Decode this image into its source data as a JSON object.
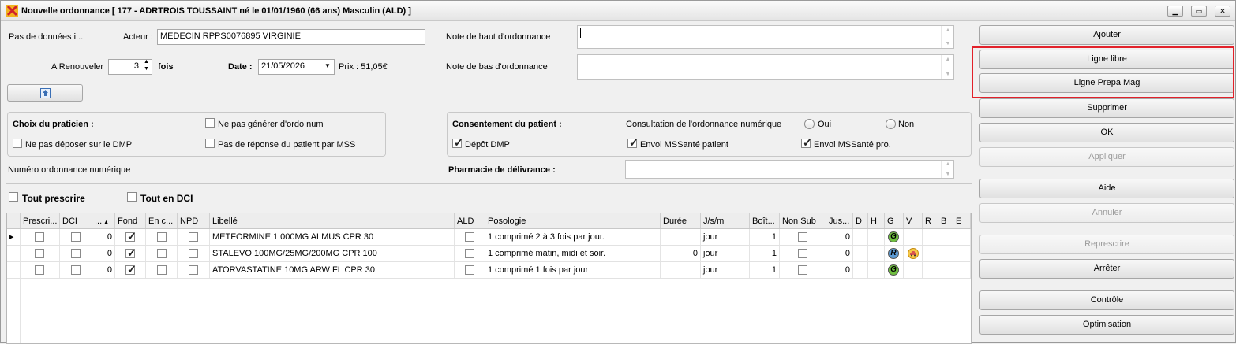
{
  "window": {
    "title": "Nouvelle ordonnance [ 177 -  ADRTROIS TOUSSAINT né le 01/01/1960 (66 ans) Masculin  (ALD) ]",
    "icon": "app-logo-icon",
    "controls": [
      "minimize-icon",
      "maximize-icon",
      "close-icon"
    ]
  },
  "header": {
    "no_data": "Pas de données i...",
    "actor_label": "Acteur :",
    "actor_value": "MEDECIN RPPS0076895 VIRGINIE",
    "renew_label": "A Renouveler",
    "renew_value": "3",
    "renew_unit": "fois",
    "date_label": "Date :",
    "date_value": "21/05/2026",
    "price": "Prix : 51,05€",
    "top_note_label": "Note de haut d'ordonnance",
    "bottom_note_label": "Note de bas d'ordonnance"
  },
  "praticien": {
    "title": "Choix du praticien :",
    "opt1": "Ne pas générer d'ordo num",
    "opt2": "Ne pas déposer sur le DMP",
    "opt3": "Pas de réponse du patient par MSS"
  },
  "patient": {
    "title": "Consentement du patient :",
    "consult_label": "Consultation de l'ordonnance numérique",
    "oui": "Oui",
    "non": "Non",
    "depot": "Dépôt DMP",
    "envoi_patient": "Envoi MSSanté patient",
    "envoi_pro": "Envoi MSSanté pro."
  },
  "numero_label": "Numéro ordonnance numérique",
  "pharmacie_label": "Pharmacie de délivrance :",
  "tout_prescrire": "Tout prescrire",
  "tout_dci": "Tout en DCI",
  "grid": {
    "columns": [
      "Prescri...",
      "DCI",
      "...",
      "Fond",
      "En c...",
      "NPD",
      "Libellé",
      "ALD",
      "Posologie",
      "Durée",
      "J/s/m",
      "Boît...",
      "Non Sub",
      "Jus...",
      "D",
      "H",
      "G",
      "V",
      "R",
      "B",
      "E"
    ],
    "rows": [
      {
        "num": "0",
        "fond": true,
        "libelle": "METFORMINE 1 000MG ALMUS CPR 30",
        "posologie": "1 comprimé 2 à 3 fois par jour.",
        "duree": "",
        "jsm": "jour",
        "boites": "1",
        "jus": "0",
        "g": "G",
        "v": ""
      },
      {
        "num": "0",
        "fond": true,
        "libelle": "STALEVO 100MG/25MG/200MG CPR 100",
        "posologie": "1 comprimé matin, midi et soir.",
        "duree": "0",
        "jsm": "jour",
        "boites": "1",
        "jus": "0",
        "g": "R",
        "v": "car-icon"
      },
      {
        "num": "0",
        "fond": true,
        "libelle": "ATORVASTATINE 10MG ARW FL CPR 30",
        "posologie": "1 comprimé 1 fois par jour",
        "duree": "",
        "jsm": "jour",
        "boites": "1",
        "jus": "0",
        "g": "G",
        "v": ""
      }
    ]
  },
  "buttons": {
    "ajouter": "Ajouter",
    "ligne_libre": "Ligne libre",
    "ligne_prepa": "Ligne Prepa Mag",
    "supprimer": "Supprimer",
    "ok": "OK",
    "appliquer": "Appliquer",
    "aide": "Aide",
    "annuler": "Annuler",
    "represcrire": "Represcrire",
    "arreter": "Arrêter",
    "controle": "Contrôle",
    "optimisation": "Optimisation"
  },
  "colors": {
    "highlight": "#e2212a",
    "green_badge": "#6fbf3f",
    "blue_badge": "#5b9bd5"
  }
}
